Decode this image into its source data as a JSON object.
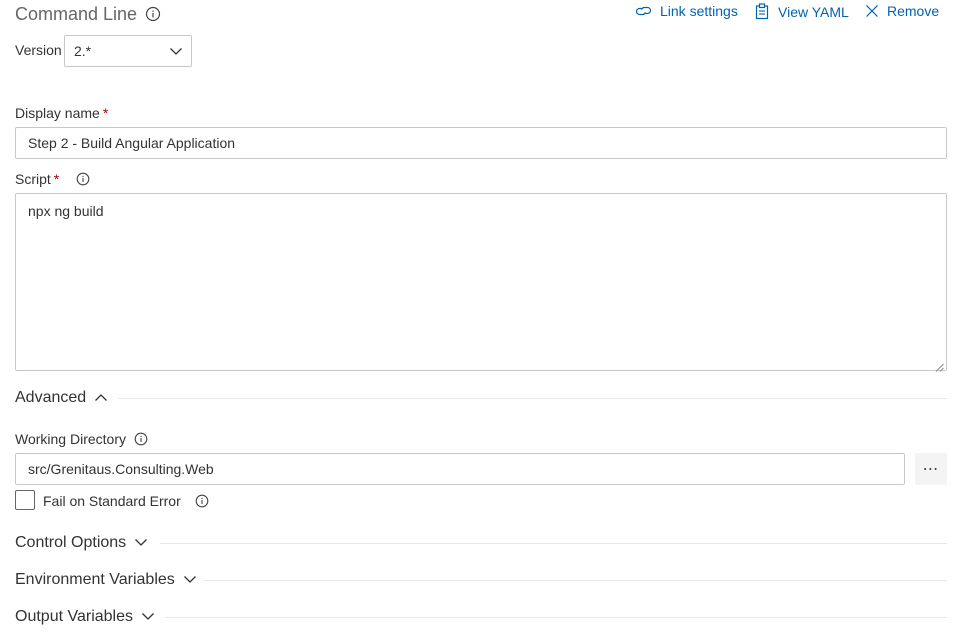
{
  "header": {
    "title": "Command Line",
    "link_settings_label": "Link settings",
    "view_yaml_label": "View YAML",
    "remove_label": "Remove"
  },
  "version": {
    "label": "Version",
    "value": "2.*"
  },
  "display_name": {
    "label": "Display name",
    "required_mark": "*",
    "value": "Step 2 - Build Angular Application"
  },
  "script": {
    "label": "Script",
    "required_mark": "*",
    "value": "npx ng build"
  },
  "advanced": {
    "label": "Advanced",
    "expanded": true,
    "working_directory": {
      "label": "Working Directory",
      "value": "src/Grenitaus.Consulting.Web",
      "browse_label": "⋯"
    },
    "fail_on_stderr": {
      "label": "Fail on Standard Error",
      "checked": false
    }
  },
  "sections": {
    "control_options": "Control Options",
    "environment_variables": "Environment Variables",
    "output_variables": "Output Variables"
  },
  "colors": {
    "accent": "#0063b1",
    "required": "#a80000",
    "border": "#c8c8c8",
    "divider": "#e8e8e8"
  },
  "icons": {
    "title_info": "info-icon",
    "link": "link-icon",
    "yaml": "clipboard-icon",
    "remove": "close-icon",
    "dropdown": "chevron-down-icon",
    "collapse": "chevron-up-icon",
    "expand": "chevron-down-icon"
  }
}
